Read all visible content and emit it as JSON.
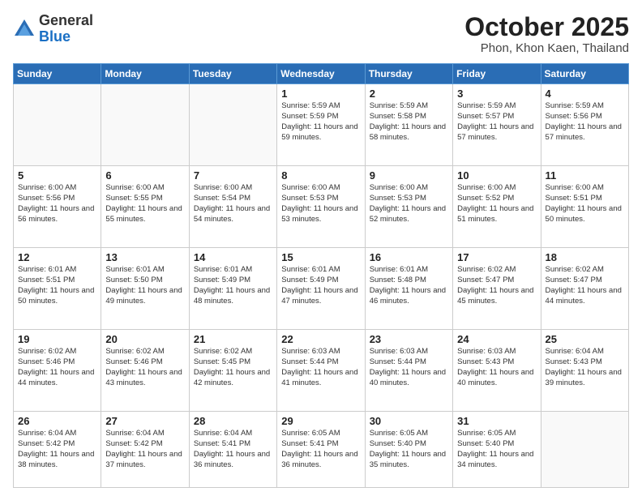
{
  "header": {
    "logo": {
      "general": "General",
      "blue": "Blue"
    },
    "title": "October 2025",
    "location": "Phon, Khon Kaen, Thailand"
  },
  "weekdays": [
    "Sunday",
    "Monday",
    "Tuesday",
    "Wednesday",
    "Thursday",
    "Friday",
    "Saturday"
  ],
  "weeks": [
    [
      {
        "day": "",
        "sunrise": "",
        "sunset": "",
        "daylight": ""
      },
      {
        "day": "",
        "sunrise": "",
        "sunset": "",
        "daylight": ""
      },
      {
        "day": "",
        "sunrise": "",
        "sunset": "",
        "daylight": ""
      },
      {
        "day": "1",
        "sunrise": "Sunrise: 5:59 AM",
        "sunset": "Sunset: 5:59 PM",
        "daylight": "Daylight: 11 hours and 59 minutes."
      },
      {
        "day": "2",
        "sunrise": "Sunrise: 5:59 AM",
        "sunset": "Sunset: 5:58 PM",
        "daylight": "Daylight: 11 hours and 58 minutes."
      },
      {
        "day": "3",
        "sunrise": "Sunrise: 5:59 AM",
        "sunset": "Sunset: 5:57 PM",
        "daylight": "Daylight: 11 hours and 57 minutes."
      },
      {
        "day": "4",
        "sunrise": "Sunrise: 5:59 AM",
        "sunset": "Sunset: 5:56 PM",
        "daylight": "Daylight: 11 hours and 57 minutes."
      }
    ],
    [
      {
        "day": "5",
        "sunrise": "Sunrise: 6:00 AM",
        "sunset": "Sunset: 5:56 PM",
        "daylight": "Daylight: 11 hours and 56 minutes."
      },
      {
        "day": "6",
        "sunrise": "Sunrise: 6:00 AM",
        "sunset": "Sunset: 5:55 PM",
        "daylight": "Daylight: 11 hours and 55 minutes."
      },
      {
        "day": "7",
        "sunrise": "Sunrise: 6:00 AM",
        "sunset": "Sunset: 5:54 PM",
        "daylight": "Daylight: 11 hours and 54 minutes."
      },
      {
        "day": "8",
        "sunrise": "Sunrise: 6:00 AM",
        "sunset": "Sunset: 5:53 PM",
        "daylight": "Daylight: 11 hours and 53 minutes."
      },
      {
        "day": "9",
        "sunrise": "Sunrise: 6:00 AM",
        "sunset": "Sunset: 5:53 PM",
        "daylight": "Daylight: 11 hours and 52 minutes."
      },
      {
        "day": "10",
        "sunrise": "Sunrise: 6:00 AM",
        "sunset": "Sunset: 5:52 PM",
        "daylight": "Daylight: 11 hours and 51 minutes."
      },
      {
        "day": "11",
        "sunrise": "Sunrise: 6:00 AM",
        "sunset": "Sunset: 5:51 PM",
        "daylight": "Daylight: 11 hours and 50 minutes."
      }
    ],
    [
      {
        "day": "12",
        "sunrise": "Sunrise: 6:01 AM",
        "sunset": "Sunset: 5:51 PM",
        "daylight": "Daylight: 11 hours and 50 minutes."
      },
      {
        "day": "13",
        "sunrise": "Sunrise: 6:01 AM",
        "sunset": "Sunset: 5:50 PM",
        "daylight": "Daylight: 11 hours and 49 minutes."
      },
      {
        "day": "14",
        "sunrise": "Sunrise: 6:01 AM",
        "sunset": "Sunset: 5:49 PM",
        "daylight": "Daylight: 11 hours and 48 minutes."
      },
      {
        "day": "15",
        "sunrise": "Sunrise: 6:01 AM",
        "sunset": "Sunset: 5:49 PM",
        "daylight": "Daylight: 11 hours and 47 minutes."
      },
      {
        "day": "16",
        "sunrise": "Sunrise: 6:01 AM",
        "sunset": "Sunset: 5:48 PM",
        "daylight": "Daylight: 11 hours and 46 minutes."
      },
      {
        "day": "17",
        "sunrise": "Sunrise: 6:02 AM",
        "sunset": "Sunset: 5:47 PM",
        "daylight": "Daylight: 11 hours and 45 minutes."
      },
      {
        "day": "18",
        "sunrise": "Sunrise: 6:02 AM",
        "sunset": "Sunset: 5:47 PM",
        "daylight": "Daylight: 11 hours and 44 minutes."
      }
    ],
    [
      {
        "day": "19",
        "sunrise": "Sunrise: 6:02 AM",
        "sunset": "Sunset: 5:46 PM",
        "daylight": "Daylight: 11 hours and 44 minutes."
      },
      {
        "day": "20",
        "sunrise": "Sunrise: 6:02 AM",
        "sunset": "Sunset: 5:46 PM",
        "daylight": "Daylight: 11 hours and 43 minutes."
      },
      {
        "day": "21",
        "sunrise": "Sunrise: 6:02 AM",
        "sunset": "Sunset: 5:45 PM",
        "daylight": "Daylight: 11 hours and 42 minutes."
      },
      {
        "day": "22",
        "sunrise": "Sunrise: 6:03 AM",
        "sunset": "Sunset: 5:44 PM",
        "daylight": "Daylight: 11 hours and 41 minutes."
      },
      {
        "day": "23",
        "sunrise": "Sunrise: 6:03 AM",
        "sunset": "Sunset: 5:44 PM",
        "daylight": "Daylight: 11 hours and 40 minutes."
      },
      {
        "day": "24",
        "sunrise": "Sunrise: 6:03 AM",
        "sunset": "Sunset: 5:43 PM",
        "daylight": "Daylight: 11 hours and 40 minutes."
      },
      {
        "day": "25",
        "sunrise": "Sunrise: 6:04 AM",
        "sunset": "Sunset: 5:43 PM",
        "daylight": "Daylight: 11 hours and 39 minutes."
      }
    ],
    [
      {
        "day": "26",
        "sunrise": "Sunrise: 6:04 AM",
        "sunset": "Sunset: 5:42 PM",
        "daylight": "Daylight: 11 hours and 38 minutes."
      },
      {
        "day": "27",
        "sunrise": "Sunrise: 6:04 AM",
        "sunset": "Sunset: 5:42 PM",
        "daylight": "Daylight: 11 hours and 37 minutes."
      },
      {
        "day": "28",
        "sunrise": "Sunrise: 6:04 AM",
        "sunset": "Sunset: 5:41 PM",
        "daylight": "Daylight: 11 hours and 36 minutes."
      },
      {
        "day": "29",
        "sunrise": "Sunrise: 6:05 AM",
        "sunset": "Sunset: 5:41 PM",
        "daylight": "Daylight: 11 hours and 36 minutes."
      },
      {
        "day": "30",
        "sunrise": "Sunrise: 6:05 AM",
        "sunset": "Sunset: 5:40 PM",
        "daylight": "Daylight: 11 hours and 35 minutes."
      },
      {
        "day": "31",
        "sunrise": "Sunrise: 6:05 AM",
        "sunset": "Sunset: 5:40 PM",
        "daylight": "Daylight: 11 hours and 34 minutes."
      },
      {
        "day": "",
        "sunrise": "",
        "sunset": "",
        "daylight": ""
      }
    ]
  ]
}
